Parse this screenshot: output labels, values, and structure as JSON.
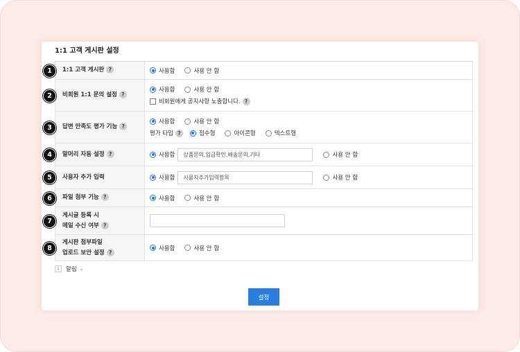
{
  "card": {
    "title": "1:1 고객 게시판 설정"
  },
  "rows": [
    {
      "number": "1",
      "label": "1:1 고객 게시판",
      "opt_use": "사용함",
      "opt_nouse": "사용 안 함"
    },
    {
      "number": "2",
      "label": "비회원 1:1 문의 설정",
      "opt_use": "사용함",
      "opt_nouse": "사용 안 함",
      "checkbox_label": "비회원에게 공지사항 노출합니다."
    },
    {
      "number": "3",
      "label": "답변 만족도 평가 기능",
      "opt_use": "사용함",
      "opt_nouse": "사용 안 함",
      "rating_label": "평가 타입",
      "rating_score": "점수형",
      "rating_icon": "아이콘형",
      "rating_text": "텍스트형"
    },
    {
      "number": "4",
      "label": "말머리 자동 설정",
      "opt_use": "사용함",
      "input_value": "상품문의,입금확인,배송문의,기타",
      "opt_nouse": "사용 안 함"
    },
    {
      "number": "5",
      "label": "사용자 추가 입력",
      "opt_use": "사용함",
      "input_value": "사용자추가입력항목",
      "opt_nouse": "사용 안 함"
    },
    {
      "number": "6",
      "label": "파일 첨부 기능",
      "opt_use": "사용함",
      "opt_nouse": "사용 안 함"
    },
    {
      "number": "7",
      "label_line1": "게시글 등록 시",
      "label_line2": "메일 수신 여부",
      "input_value": ""
    },
    {
      "number": "8",
      "label_line1": "게시판 첨부파일",
      "label_line2": "업로드 보안 설정",
      "opt_use": "사용함",
      "opt_nouse": "사용 안 함"
    }
  ],
  "help_glyph": "?",
  "notice": {
    "icon": "i",
    "label": "알림",
    "chevron": "⌄"
  },
  "submit": {
    "label": "설정"
  },
  "colors": {
    "accent": "#2a7de1",
    "frame": "#fcebe7"
  }
}
